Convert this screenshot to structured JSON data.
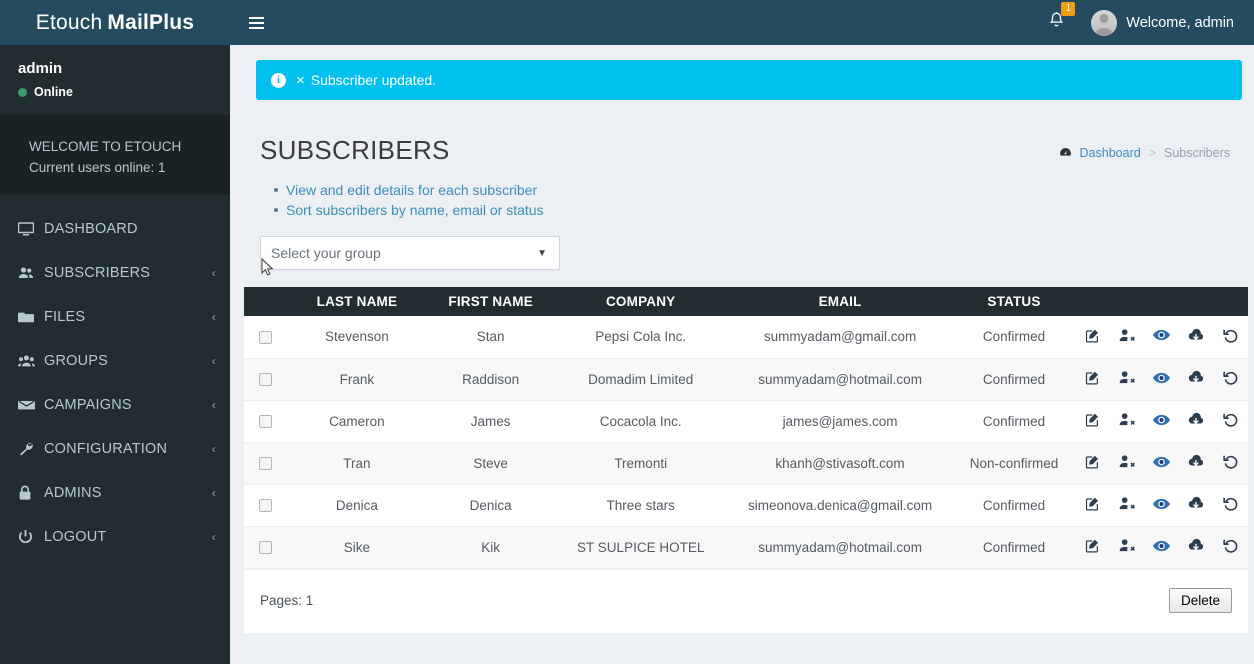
{
  "header": {
    "logo_light": "Etouch",
    "logo_bold": "MailPlus",
    "menu_toggle_icon": "hamburger-icon",
    "notification_icon": "bell-icon",
    "notification_count": "1",
    "user_greeting": "Welcome, admin",
    "avatar_icon": "user-avatar"
  },
  "sidebar": {
    "user_name": "admin",
    "user_status": "Online",
    "status_color": "#3d9970",
    "welcome_line1": "WELCOME TO ETOUCH",
    "welcome_line2": "Current users online: 1",
    "items": [
      {
        "label": "DASHBOARD",
        "icon": "desktop-icon",
        "arrow": ""
      },
      {
        "label": "SUBSCRIBERS",
        "icon": "users-icon",
        "arrow": "‹"
      },
      {
        "label": "FILES",
        "icon": "folder-icon",
        "arrow": "‹"
      },
      {
        "label": "GROUPS",
        "icon": "group-icon",
        "arrow": "‹"
      },
      {
        "label": "CAMPAIGNS",
        "icon": "envelope-icon",
        "arrow": "‹"
      },
      {
        "label": "CONFIGURATION",
        "icon": "wrench-icon",
        "arrow": "‹"
      },
      {
        "label": "ADMINS",
        "icon": "lock-icon",
        "arrow": "‹"
      },
      {
        "label": "LOGOUT",
        "icon": "power-icon",
        "arrow": "‹"
      }
    ]
  },
  "alert": {
    "icon": "info-circle-icon",
    "close_label": "×",
    "message": "Subscriber updated.",
    "color": "#00c0ef"
  },
  "page": {
    "title": "SUBSCRIBERS",
    "breadcrumb_icon": "dashboard-icon",
    "breadcrumb_home": "Dashboard",
    "breadcrumb_sep": ">",
    "breadcrumb_current": "Subscribers",
    "bullets": [
      "View and edit details for each subscriber",
      "Sort subscribers by name, email or status"
    ]
  },
  "group_select": {
    "value": "Select your group",
    "caret_icon": "chevron-down-icon"
  },
  "table": {
    "columns": [
      "",
      "LAST NAME",
      "FIRST NAME",
      "COMPANY",
      "EMAIL",
      "STATUS"
    ],
    "action_icons": [
      "edit-icon",
      "user-remove-icon",
      "eye-icon",
      "cloud-download-icon",
      "undo-icon"
    ],
    "rows": [
      {
        "last": "Stevenson",
        "first": "Stan",
        "company": "Pepsi Cola Inc.",
        "email": "summyadam@gmail.com",
        "status": "Confirmed"
      },
      {
        "last": "Frank",
        "first": "Raddison",
        "company": "Domadim Limited",
        "email": "summyadam@hotmail.com",
        "status": "Confirmed"
      },
      {
        "last": "Cameron",
        "first": "James",
        "company": "Cocacola Inc.",
        "email": "james@james.com",
        "status": "Confirmed"
      },
      {
        "last": "Tran",
        "first": "Steve",
        "company": "Tremonti",
        "email": "khanh@stivasoft.com",
        "status": "Non-confirmed"
      },
      {
        "last": "Denica",
        "first": "Denica",
        "company": "Three stars",
        "email": "simeonova.denica@gmail.com",
        "status": "Confirmed"
      },
      {
        "last": "Sike",
        "first": "Kik",
        "company": "ST SULPICE HOTEL",
        "email": "summyadam@hotmail.com",
        "status": "Confirmed"
      }
    ]
  },
  "footer": {
    "pages_label": "Pages: 1",
    "delete_label": "Delete"
  },
  "colors": {
    "header_bg": "#254b61",
    "sidebar_bg": "#222d32",
    "sidebar_welcome_bg": "#1a2226",
    "content_bg": "#ecf0f5",
    "accent_link": "#3c8dbc",
    "alert_bg": "#00c0ef",
    "badge_bg": "#f39c12"
  }
}
